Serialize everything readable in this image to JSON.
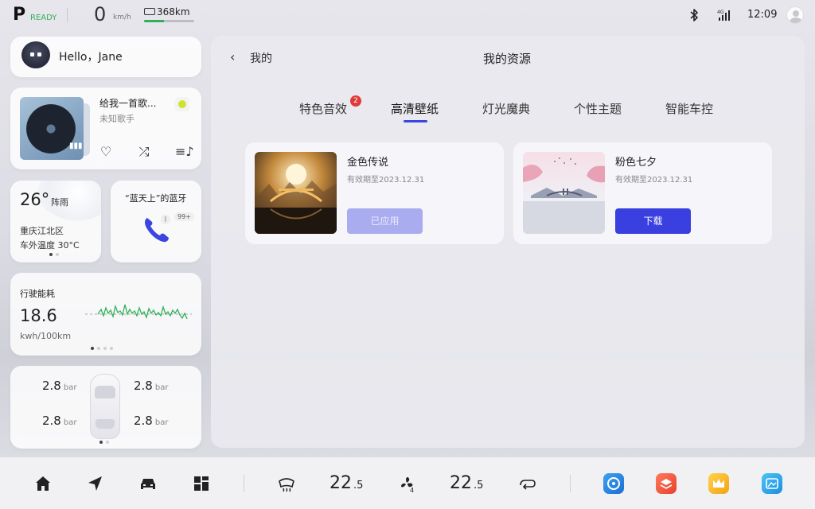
{
  "status": {
    "gear": "P",
    "ready": "READY",
    "speed": "0",
    "speed_unit": "km/h",
    "range": "368km",
    "range_level": 0.4,
    "time": "12:09",
    "icons": [
      "bluetooth-icon",
      "4g-signal-icon",
      "user-avatar-icon"
    ]
  },
  "hello": {
    "greeting": "Hello，Jane"
  },
  "music": {
    "song": "给我一首歌...",
    "artist": "未知歌手",
    "controls": [
      "heart-icon",
      "shuffle-icon",
      "playlist-icon"
    ]
  },
  "weather": {
    "temp": "26°",
    "condition": "阵雨",
    "location": "重庆江北区",
    "outside_temp": "车外温度 30°C"
  },
  "bluetooth": {
    "title": "“蓝天上”的蓝牙",
    "badge": "99+"
  },
  "energy": {
    "label": "行驶能耗",
    "value": "18.6",
    "unit": "kwh/100km"
  },
  "tyres": {
    "fl": "2.8",
    "fr": "2.8",
    "rl": "2.8",
    "rr": "2.8",
    "unit": "bar"
  },
  "main": {
    "back_label": "我的",
    "title": "我的资源",
    "tabs": [
      {
        "label": "特色音效",
        "badge": "2"
      },
      {
        "label": "高清壁纸"
      },
      {
        "label": "灯光魔典"
      },
      {
        "label": "个性主题"
      },
      {
        "label": "智能车控"
      }
    ],
    "active_tab": 1,
    "wallpapers": [
      {
        "name": "金色传说",
        "expiry": "有效期至2023.12.31",
        "button": "已应用"
      },
      {
        "name": "粉色七夕",
        "expiry": "有效期至2023.12.31",
        "button": "下载"
      }
    ]
  },
  "dock": {
    "left_temp": "22",
    "left_temp_dec": ".5",
    "right_temp": "22",
    "right_temp_dec": ".5",
    "fan_level": "4",
    "colors": {
      "accent": "#3a3fe0",
      "ready": "#2fb15a",
      "badge": "#e03a3a"
    }
  }
}
